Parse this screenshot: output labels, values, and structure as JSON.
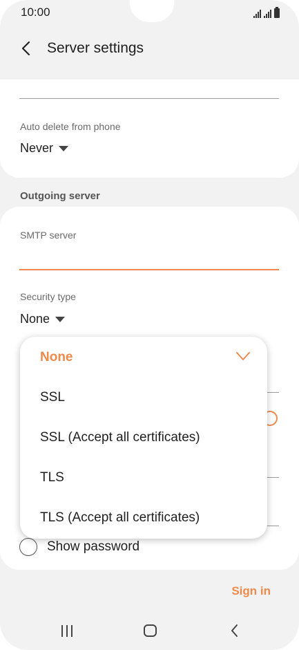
{
  "status_bar": {
    "time": "10:00"
  },
  "header": {
    "title": "Server settings"
  },
  "auto_delete": {
    "label": "Auto delete from phone",
    "value": "Never"
  },
  "outgoing_section": {
    "title": "Outgoing server"
  },
  "smtp": {
    "label": "SMTP server",
    "value": ""
  },
  "security": {
    "label": "Security type",
    "value": "None"
  },
  "dropdown": {
    "options": [
      {
        "label": "None",
        "selected": true
      },
      {
        "label": "SSL",
        "selected": false
      },
      {
        "label": "SSL (Accept all certificates)",
        "selected": false
      },
      {
        "label": "TLS",
        "selected": false
      },
      {
        "label": "TLS (Accept all certificates)",
        "selected": false
      }
    ]
  },
  "show_password": {
    "label": "Show password"
  },
  "actions": {
    "sign_in": "Sign in"
  },
  "colors": {
    "accent": "#f08a4b",
    "background": "#f2f2f2",
    "card": "#ffffff"
  },
  "icons": {
    "back": "chevron-left-icon",
    "check": "check-icon",
    "recents": "recents-icon",
    "home": "home-icon",
    "nav_back": "nav-back-icon"
  }
}
